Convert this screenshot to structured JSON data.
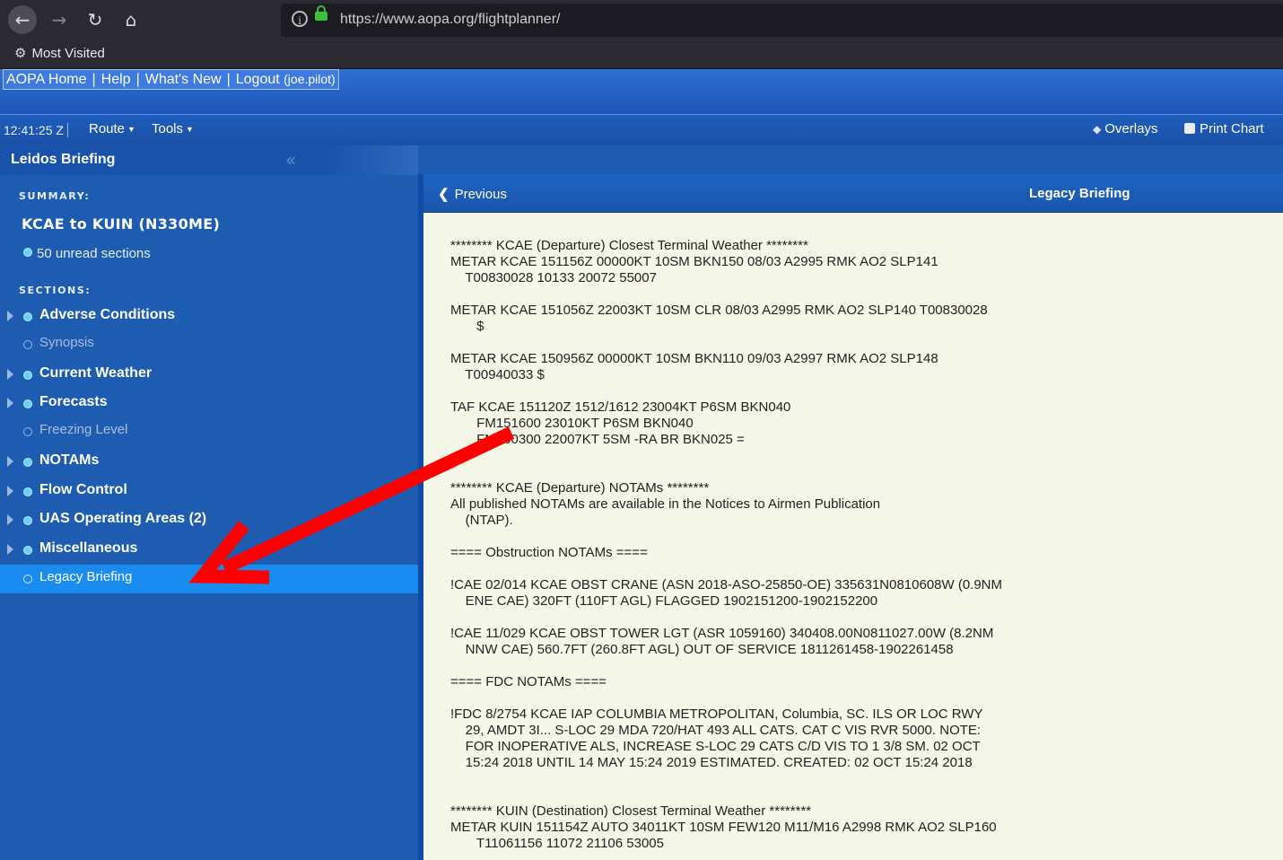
{
  "browser": {
    "url": "https://www.aopa.org/flightplanner/",
    "bookmark": "Most Visited"
  },
  "header": {
    "links": [
      "AOPA Home",
      "Help",
      "What's New",
      "Logout"
    ],
    "user": "(joe.pilot)"
  },
  "toolbar": {
    "time": "12:41:25 Z",
    "route": "Route",
    "tools": "Tools",
    "overlays": "Overlays",
    "print_chart": "Print Chart"
  },
  "sidebar": {
    "title": "Leidos Briefing",
    "summary_label": "SUMMARY:",
    "route": "KCAE to KUIN (N330ME)",
    "unread": "50 unread sections",
    "sections_label": "SECTIONS:",
    "sections": [
      {
        "label": "Adverse Conditions"
      },
      {
        "label": "Synopsis"
      },
      {
        "label": "Current Weather"
      },
      {
        "label": "Forecasts"
      },
      {
        "label": "Freezing Level"
      },
      {
        "label": "NOTAMs"
      },
      {
        "label": "Flow Control"
      },
      {
        "label": "UAS Operating Areas (2)"
      },
      {
        "label": "Miscellaneous"
      },
      {
        "label": "Legacy Briefing"
      }
    ]
  },
  "pane": {
    "previous": "Previous",
    "title": "Legacy Briefing",
    "text": "******** KCAE (Departure) Closest Terminal Weather ********\nMETAR KCAE 151156Z 00000KT 10SM BKN150 08/03 A2995 RMK AO2 SLP141\n    T00830028 10133 20072 55007\n\nMETAR KCAE 151056Z 22003KT 10SM CLR 08/03 A2995 RMK AO2 SLP140 T00830028\n       $\n\nMETAR KCAE 150956Z 00000KT 10SM BKN110 09/03 A2997 RMK AO2 SLP148\n    T00940033 $\n\nTAF KCAE 151120Z 1512/1612 23004KT P6SM BKN040\n       FM151600 23010KT P6SM BKN040\n       FM160300 22007KT 5SM -RA BR BKN025 =\n\n\n******** KCAE (Departure) NOTAMs ********\nAll published NOTAMs are available in the Notices to Airmen Publication\n    (NTAP).\n\n==== Obstruction NOTAMs ====\n\n!CAE 02/014 KCAE OBST CRANE (ASN 2018-ASO-25850-OE) 335631N0810608W (0.9NM\n    ENE CAE) 320FT (110FT AGL) FLAGGED 1902151200-1902152200\n\n!CAE 11/029 KCAE OBST TOWER LGT (ASR 1059160) 340408.00N0811027.00W (8.2NM\n    NNW CAE) 560.7FT (260.8FT AGL) OUT OF SERVICE 1811261458-1902261458\n\n==== FDC NOTAMs ====\n\n!FDC 8/2754 KCAE IAP COLUMBIA METROPOLITAN, Columbia, SC. ILS OR LOC RWY\n    29, AMDT 3I... S-LOC 29 MDA 720/HAT 493 ALL CATS. CAT C VIS RVR 5000. NOTE:\n    FOR INOPERATIVE ALS, INCREASE S-LOC 29 CATS C/D VIS TO 1 3/8 SM. 02 OCT\n    15:24 2018 UNTIL 14 MAY 15:24 2019 ESTIMATED. CREATED: 02 OCT 15:24 2018\n\n\n******** KUIN (Destination) Closest Terminal Weather ********\nMETAR KUIN 151154Z AUTO 34011KT 10SM FEW120 M11/M16 A2998 RMK AO2 SLP160\n       T11061156 11072 21106 53005"
  },
  "colors": {
    "annotation_arrow": "#ff0000",
    "active_section": "#1a8cf0",
    "content_bg": "#f5f7e9"
  }
}
